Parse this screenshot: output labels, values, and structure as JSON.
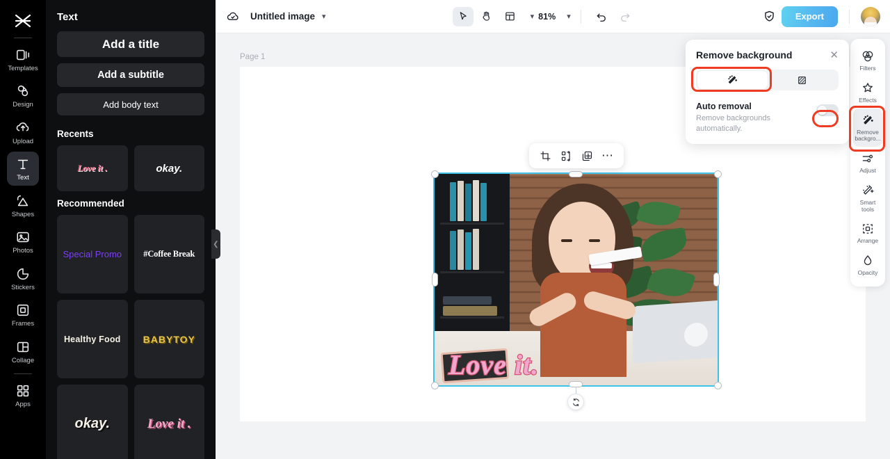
{
  "app": {
    "logo_icon": "capcut-logo-icon"
  },
  "rail": {
    "items": [
      {
        "label": "Templates",
        "icon": "templates-icon",
        "active": false
      },
      {
        "label": "Design",
        "icon": "design-icon",
        "active": false
      },
      {
        "label": "Upload",
        "icon": "upload-icon",
        "active": false
      },
      {
        "label": "Text",
        "icon": "text-icon",
        "active": true
      },
      {
        "label": "Shapes",
        "icon": "shapes-icon",
        "active": false
      },
      {
        "label": "Photos",
        "icon": "photos-icon",
        "active": false
      },
      {
        "label": "Stickers",
        "icon": "stickers-icon",
        "active": false
      },
      {
        "label": "Frames",
        "icon": "frames-icon",
        "active": false
      },
      {
        "label": "Collage",
        "icon": "collage-icon",
        "active": false
      },
      {
        "label": "Apps",
        "icon": "apps-icon",
        "active": false
      }
    ]
  },
  "panel": {
    "title": "Text",
    "buttons": {
      "add_title": "Add a title",
      "add_subtitle": "Add a subtitle",
      "add_body": "Add body text"
    },
    "recents_heading": "Recents",
    "recents": [
      {
        "label": "Love it ."
      },
      {
        "label": "okay."
      }
    ],
    "recommended_heading": "Recommended",
    "recommended": [
      {
        "label": "Special Promo"
      },
      {
        "label": "#Coffee Break"
      },
      {
        "label": "Healthy Food"
      },
      {
        "label": "BABYTOY"
      },
      {
        "label": "okay."
      },
      {
        "label": "Love it ."
      }
    ],
    "collapse_icon": "chevron-left-icon"
  },
  "topbar": {
    "cloud_icon": "cloud-saved-icon",
    "doc_title": "Untitled image",
    "title_chevron_icon": "chevron-down-icon",
    "select_tool_icon": "cursor-arrow-icon",
    "hand_tool_icon": "hand-icon",
    "layout_icon": "layout-panel-icon",
    "layout_chevron_icon": "chevron-down-icon",
    "zoom_value": "81%",
    "zoom_chevron_icon": "chevron-down-icon",
    "undo_icon": "undo-icon",
    "redo_icon": "redo-icon",
    "shield_icon": "shield-check-icon",
    "export_label": "Export",
    "avatar_icon": "user-avatar"
  },
  "canvas": {
    "page_label": "Page 1",
    "object_toolbar": [
      {
        "icon": "crop-icon"
      },
      {
        "icon": "replace-image-icon"
      },
      {
        "icon": "duplicate-icon"
      },
      {
        "icon": "more-options-icon"
      }
    ],
    "selected_image": {
      "overlay_text": "Love it.",
      "rotate_icon": "rotate-icon"
    }
  },
  "remove_background_panel": {
    "title": "Remove background",
    "close_icon": "close-icon",
    "tabs": [
      {
        "icon": "magic-wand-icon",
        "active": true
      },
      {
        "icon": "checker-pattern-icon",
        "active": false
      }
    ],
    "auto_removal": {
      "label": "Auto removal",
      "description": "Remove backgrounds automatically.",
      "enabled": false
    }
  },
  "right_tools": {
    "items": [
      {
        "label": "Filters",
        "icon": "filters-icon",
        "active": false
      },
      {
        "label": "Effects",
        "icon": "effects-icon",
        "active": false
      },
      {
        "label": "Remove backgro...",
        "icon": "remove-background-icon",
        "active": true
      },
      {
        "label": "Adjust",
        "icon": "adjust-icon",
        "active": false
      },
      {
        "label": "Smart tools",
        "icon": "smart-tools-icon",
        "active": false
      },
      {
        "label": "Arrange",
        "icon": "arrange-icon",
        "active": false
      },
      {
        "label": "Opacity",
        "icon": "opacity-icon",
        "active": false
      }
    ]
  },
  "annotations": {
    "color": "#ef3b21",
    "boxes": [
      {
        "target": "auto-removal-tab"
      },
      {
        "target": "auto-removal-toggle"
      },
      {
        "target": "remove-background-tool"
      }
    ]
  }
}
